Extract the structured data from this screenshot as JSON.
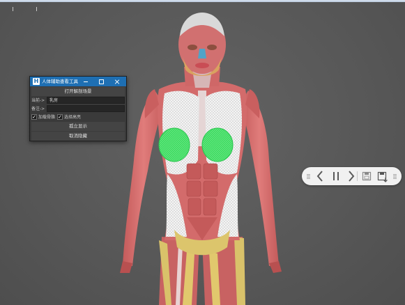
{
  "tool_window": {
    "title": "人体辅助查看工具",
    "app_icon_letter": "H",
    "open_button": "打开解剖场景",
    "name_label": "当前->",
    "name_value": "乳房",
    "note_label": "备注->",
    "note_value": "",
    "checkbox_skeleton": {
      "label": "加载骨骼",
      "checked": true
    },
    "checkbox_mark": {
      "label": "选择高亮",
      "checked": true
    },
    "isolate_button": "孤立显示",
    "cancel_hide_button": "取消隐藏"
  },
  "media_controls": {
    "icons": [
      "grip-icon",
      "previous-icon",
      "pause-icon",
      "next-icon",
      "save-icon",
      "save-as-icon",
      "grip-icon"
    ]
  },
  "colors": {
    "background": "#5a5a5a",
    "titlebar": "#1e6fb3",
    "muscle": "#d46a6a",
    "fascia": "#f2f2f2",
    "highlight": "#35d85a"
  }
}
